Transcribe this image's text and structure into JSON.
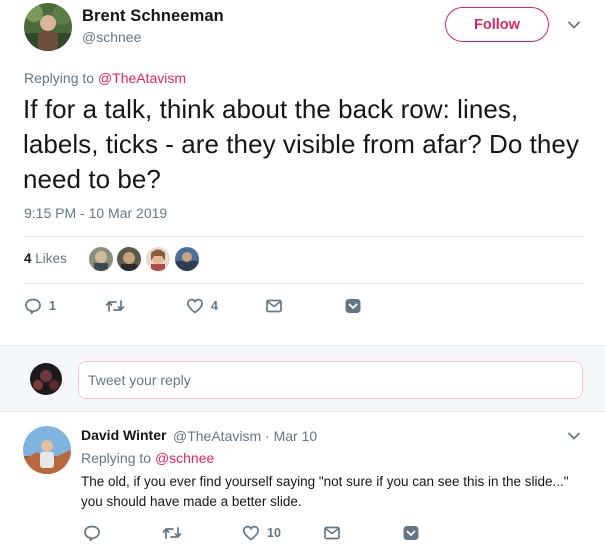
{
  "main_tweet": {
    "author_name": "Brent Schneeman",
    "author_handle": "@schnee",
    "follow_label": "Follow",
    "replying_prefix": "Replying to",
    "replying_to": "@TheAtavism",
    "text": "If for a talk, think about the back row: lines, labels, ticks - are they visible from afar? Do they need to be?",
    "timestamp": "9:15 PM - 10 Mar 2019",
    "likes_count": "4",
    "likes_label": "Likes",
    "actions": {
      "reply_count": "1",
      "retweet_count": "",
      "like_count": "4"
    }
  },
  "composer": {
    "placeholder": "Tweet your reply"
  },
  "reply_tweet": {
    "author_name": "David Winter",
    "author_handle": "@TheAtavism",
    "separator": "·",
    "date": "Mar 10",
    "replying_prefix": "Replying to",
    "replying_to": "@schnee",
    "text_line1": "The old, if you ever find yourself saying \"not sure if you can see this in the slide...\"",
    "text_line2": "you should have made a better slide.",
    "actions": {
      "reply_count": "",
      "retweet_count": "",
      "like_count": "10"
    }
  },
  "icons": {
    "caret": "chevron-down-icon",
    "reply": "reply-icon",
    "retweet": "retweet-icon",
    "like": "heart-icon",
    "message": "envelope-icon",
    "save": "save-icon"
  },
  "colors": {
    "accent": "#e0245e",
    "muted": "#657786",
    "text": "#14171a",
    "border": "#e6ecf0",
    "composer_bg": "#f5f8fa"
  }
}
